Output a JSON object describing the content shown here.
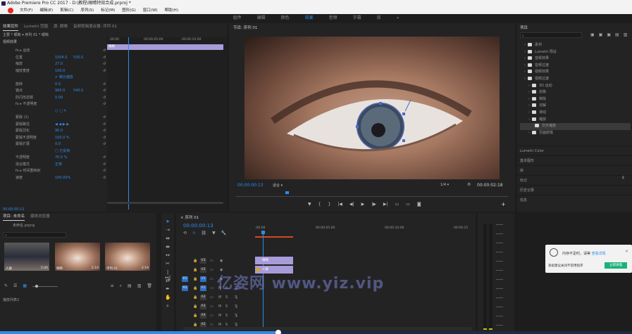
{
  "app": {
    "title": "Adobe Premiere Pro CC 2017 - D:\\教程\\眼睛特效合成.prproj *",
    "menu": [
      "文件(F)",
      "编辑(E)",
      "剪辑(C)",
      "序列(S)",
      "标记(M)",
      "图形(G)",
      "窗口(W)",
      "帮助(H)"
    ]
  },
  "workspace_tabs": [
    "组件",
    "编辑",
    "颜色",
    "效果",
    "音频",
    "字幕",
    "库",
    "»"
  ],
  "workspace_active": "效果",
  "effect_controls": {
    "tabs": [
      "效果控件",
      "Lumetri 范围",
      "源: 眼睛",
      "音频剪辑混合器: 序列 01"
    ],
    "header": "主要 * 眼睛 ▾  序列 01 * 眼睛",
    "clip_label": "眼睛",
    "section_video": "视频效果",
    "rows": [
      {
        "name": "fx ▸ 运动",
        "v1": "",
        "v2": ""
      },
      {
        "name": "位置",
        "v1": "1004.0",
        "v2": "530.0"
      },
      {
        "name": "缩放",
        "v1": "27.0",
        "v2": ""
      },
      {
        "name": "缩放宽度",
        "v1": "100.0",
        "v2": ""
      },
      {
        "name": "",
        "v1": "✔ 等比缩放",
        "v2": ""
      },
      {
        "name": "旋转",
        "v1": "0.0",
        "v2": ""
      },
      {
        "name": "锚点",
        "v1": "960.0",
        "v2": "540.0"
      },
      {
        "name": "防闪烁滤镜",
        "v1": "0.00",
        "v2": ""
      },
      {
        "name": "fx ▸ 不透明度",
        "v1": "",
        "v2": ""
      },
      {
        "name": "",
        "v1": "○ □ ✎",
        "v2": ""
      },
      {
        "name": "蒙版 (1)",
        "v1": "",
        "v2": ""
      },
      {
        "name": "蒙版路径",
        "v1": "◀ ◀ ▶ ▶",
        "v2": ""
      },
      {
        "name": "蒙版羽化",
        "v1": "90.0",
        "v2": ""
      },
      {
        "name": "蒙版不透明度",
        "v1": "100.0 %",
        "v2": ""
      },
      {
        "name": "蒙版扩展",
        "v1": "0.0",
        "v2": ""
      },
      {
        "name": "",
        "v1": "□ 已反转",
        "v2": ""
      },
      {
        "name": "不透明度",
        "v1": "70.0 %",
        "v2": ""
      },
      {
        "name": "混合模式",
        "v1": "正常",
        "v2": ""
      },
      {
        "name": "fx ▸ 时间重映射",
        "v1": "",
        "v2": ""
      },
      {
        "name": "速度",
        "v1": "100.00%",
        "v2": ""
      }
    ],
    "ruler": [
      "00:00",
      "00:00:05:00",
      "00:00:10:00"
    ],
    "timecode": "00:00:00:13"
  },
  "program_monitor": {
    "title": "节目: 序列 01",
    "timecode_left": "00:00:00:13",
    "fit": "适合",
    "quality": "1/4",
    "timecode_right": "00:00:02:18"
  },
  "project_panel": {
    "title": "项目",
    "items": [
      {
        "label": "素材",
        "indent": 1
      },
      {
        "label": "Lumetri 预设",
        "indent": 1
      },
      {
        "label": "音频效果",
        "indent": 1
      },
      {
        "label": "音频过渡",
        "indent": 1
      },
      {
        "label": "视频效果",
        "indent": 1
      },
      {
        "label": "视频过渡",
        "indent": 1
      },
      {
        "label": "3D 运动",
        "indent": 2
      },
      {
        "label": "划像",
        "indent": 2
      },
      {
        "label": "擦除",
        "indent": 2
      },
      {
        "label": "溶解",
        "indent": 2
      },
      {
        "label": "滑动",
        "indent": 2
      },
      {
        "label": "缩放",
        "indent": 2
      },
      {
        "label": "交叉缩放",
        "indent": 3
      },
      {
        "label": "页面剥落",
        "indent": 2
      }
    ],
    "sections": [
      "Lumetri Color",
      "基本图形",
      "库",
      "标记",
      "历史记录",
      "信息"
    ]
  },
  "media_bin": {
    "tabs": [
      "项目: 未命名",
      "媒体浏览器"
    ],
    "file": "未命名.prproj",
    "thumbs": [
      {
        "label": "人群",
        "duration": "5:00"
      },
      {
        "label": "眼睛",
        "duration": "2:18"
      },
      {
        "label": "序列 01",
        "duration": "2:18"
      }
    ],
    "status": "播放列表2"
  },
  "timeline": {
    "title": "序列 01",
    "timecode": "00:00:00:13",
    "ruler": [
      ":00:00",
      "00:00:05:00",
      "00:00:10:00",
      "00:00:15"
    ],
    "tracks": [
      {
        "id": "V3",
        "type": "video"
      },
      {
        "id": "V2",
        "type": "video"
      },
      {
        "id": "V1",
        "type": "video",
        "source": "V1"
      },
      {
        "id": "A1",
        "type": "audio",
        "source": "A1"
      },
      {
        "id": "A2",
        "type": "audio"
      },
      {
        "id": "A3",
        "type": "audio"
      },
      {
        "id": "A4",
        "type": "audio"
      },
      {
        "id": "A5",
        "type": "audio"
      },
      {
        "id": "A6",
        "type": "audio"
      }
    ],
    "clips": [
      {
        "label": "眼睛",
        "track": "V3"
      },
      {
        "label": "人群",
        "track": "V2"
      }
    ]
  },
  "notification": {
    "line1": "内存不足时，请等",
    "link": "查看详情",
    "line2": "系统建议关闭不常用程序",
    "button": "立即清理"
  },
  "watermark": "亿姿网 www.yiz.vip",
  "colors": {
    "accent": "#2d8ceb",
    "clip_purple": "#a89bd9",
    "bg": "#1d1d1d",
    "panel": "#232323"
  }
}
